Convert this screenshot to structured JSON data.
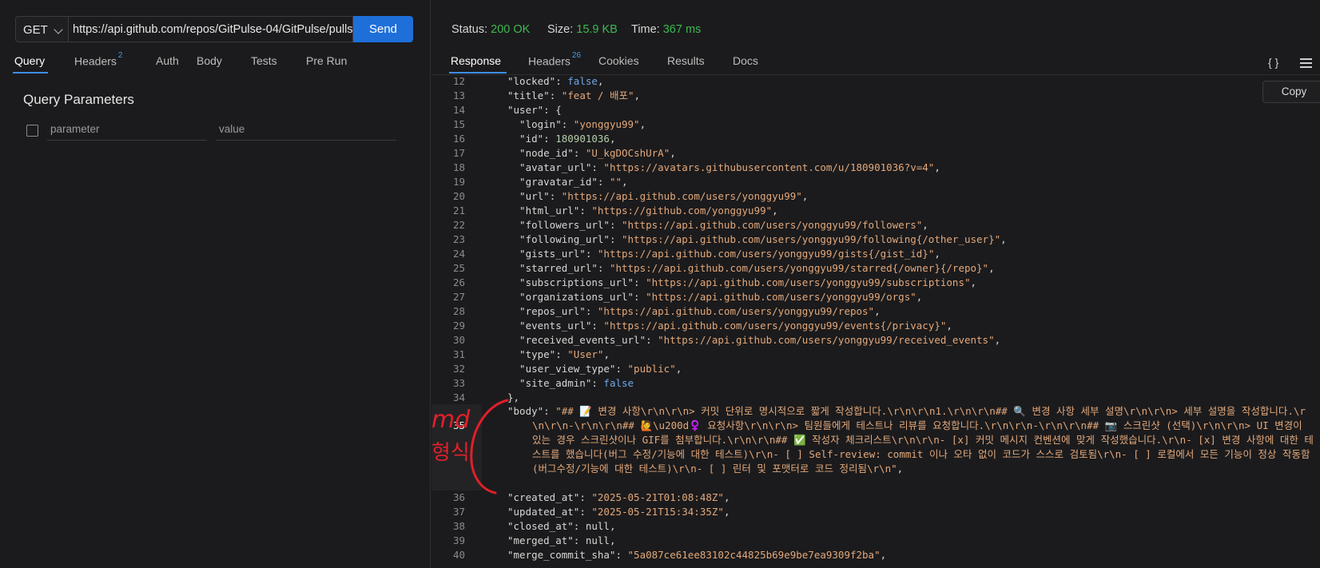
{
  "request": {
    "method": "GET",
    "url": "https://api.github.com/repos/GitPulse-04/GitPulse/pulls",
    "send_label": "Send"
  },
  "request_tabs": [
    {
      "label": "Query",
      "active": true
    },
    {
      "label": "Headers",
      "badge": "2"
    },
    {
      "label": "Auth"
    },
    {
      "label": "Body"
    },
    {
      "label": "Tests"
    },
    {
      "label": "Pre Run"
    }
  ],
  "query_params": {
    "title": "Query Parameters",
    "param_placeholder": "parameter",
    "value_placeholder": "value"
  },
  "status": {
    "status_label": "Status:",
    "status_value": "200 OK",
    "size_label": "Size:",
    "size_value": "15.9 KB",
    "time_label": "Time:",
    "time_value": "367 ms"
  },
  "response_tabs": [
    {
      "label": "Response",
      "active": true
    },
    {
      "label": "Headers",
      "badge": "26"
    },
    {
      "label": "Cookies"
    },
    {
      "label": "Results"
    },
    {
      "label": "Docs"
    }
  ],
  "toolbar": {
    "braces_glyph": "{ }",
    "copy_label": "Copy"
  },
  "code_lines": [
    {
      "n": "12",
      "parts": [
        [
          "k",
          "\"locked\""
        ],
        [
          "p",
          ": "
        ],
        [
          "b",
          "false"
        ],
        [
          "p",
          ","
        ]
      ]
    },
    {
      "n": "13",
      "parts": [
        [
          "k",
          "\"title\""
        ],
        [
          "p",
          ": "
        ],
        [
          "s",
          "\"feat / 배포\""
        ],
        [
          "p",
          ","
        ]
      ]
    },
    {
      "n": "14",
      "parts": [
        [
          "k",
          "\"user\""
        ],
        [
          "p",
          ": {"
        ]
      ]
    },
    {
      "n": "15",
      "parts": [
        [
          "k",
          "  \"login\""
        ],
        [
          "p",
          ": "
        ],
        [
          "s",
          "\"yonggyu99\""
        ],
        [
          "p",
          ","
        ]
      ]
    },
    {
      "n": "16",
      "parts": [
        [
          "k",
          "  \"id\""
        ],
        [
          "p",
          ": "
        ],
        [
          "n",
          "180901036"
        ],
        [
          "p",
          ","
        ]
      ]
    },
    {
      "n": "17",
      "parts": [
        [
          "k",
          "  \"node_id\""
        ],
        [
          "p",
          ": "
        ],
        [
          "s",
          "\"U_kgDOCshUrA\""
        ],
        [
          "p",
          ","
        ]
      ]
    },
    {
      "n": "18",
      "parts": [
        [
          "k",
          "  \"avatar_url\""
        ],
        [
          "p",
          ": "
        ],
        [
          "s",
          "\"https://avatars.githubusercontent.com/u/180901036?v=4\""
        ],
        [
          "p",
          ","
        ]
      ]
    },
    {
      "n": "19",
      "parts": [
        [
          "k",
          "  \"gravatar_id\""
        ],
        [
          "p",
          ": "
        ],
        [
          "s",
          "\"\""
        ],
        [
          "p",
          ","
        ]
      ]
    },
    {
      "n": "20",
      "parts": [
        [
          "k",
          "  \"url\""
        ],
        [
          "p",
          ": "
        ],
        [
          "s",
          "\"https://api.github.com/users/yonggyu99\""
        ],
        [
          "p",
          ","
        ]
      ]
    },
    {
      "n": "21",
      "parts": [
        [
          "k",
          "  \"html_url\""
        ],
        [
          "p",
          ": "
        ],
        [
          "s",
          "\"https://github.com/yonggyu99\""
        ],
        [
          "p",
          ","
        ]
      ]
    },
    {
      "n": "22",
      "parts": [
        [
          "k",
          "  \"followers_url\""
        ],
        [
          "p",
          ": "
        ],
        [
          "s",
          "\"https://api.github.com/users/yonggyu99/followers\""
        ],
        [
          "p",
          ","
        ]
      ]
    },
    {
      "n": "23",
      "parts": [
        [
          "k",
          "  \"following_url\""
        ],
        [
          "p",
          ": "
        ],
        [
          "s",
          "\"https://api.github.com/users/yonggyu99/following{/other_user}\""
        ],
        [
          "p",
          ","
        ]
      ]
    },
    {
      "n": "24",
      "parts": [
        [
          "k",
          "  \"gists_url\""
        ],
        [
          "p",
          ": "
        ],
        [
          "s",
          "\"https://api.github.com/users/yonggyu99/gists{/gist_id}\""
        ],
        [
          "p",
          ","
        ]
      ]
    },
    {
      "n": "25",
      "parts": [
        [
          "k",
          "  \"starred_url\""
        ],
        [
          "p",
          ": "
        ],
        [
          "s",
          "\"https://api.github.com/users/yonggyu99/starred{/owner}{/repo}\""
        ],
        [
          "p",
          ","
        ]
      ]
    },
    {
      "n": "26",
      "parts": [
        [
          "k",
          "  \"subscriptions_url\""
        ],
        [
          "p",
          ": "
        ],
        [
          "s",
          "\"https://api.github.com/users/yonggyu99/subscriptions\""
        ],
        [
          "p",
          ","
        ]
      ]
    },
    {
      "n": "27",
      "parts": [
        [
          "k",
          "  \"organizations_url\""
        ],
        [
          "p",
          ": "
        ],
        [
          "s",
          "\"https://api.github.com/users/yonggyu99/orgs\""
        ],
        [
          "p",
          ","
        ]
      ]
    },
    {
      "n": "28",
      "parts": [
        [
          "k",
          "  \"repos_url\""
        ],
        [
          "p",
          ": "
        ],
        [
          "s",
          "\"https://api.github.com/users/yonggyu99/repos\""
        ],
        [
          "p",
          ","
        ]
      ]
    },
    {
      "n": "29",
      "parts": [
        [
          "k",
          "  \"events_url\""
        ],
        [
          "p",
          ": "
        ],
        [
          "s",
          "\"https://api.github.com/users/yonggyu99/events{/privacy}\""
        ],
        [
          "p",
          ","
        ]
      ]
    },
    {
      "n": "30",
      "parts": [
        [
          "k",
          "  \"received_events_url\""
        ],
        [
          "p",
          ": "
        ],
        [
          "s",
          "\"https://api.github.com/users/yonggyu99/received_events\""
        ],
        [
          "p",
          ","
        ]
      ]
    },
    {
      "n": "31",
      "parts": [
        [
          "k",
          "  \"type\""
        ],
        [
          "p",
          ": "
        ],
        [
          "s",
          "\"User\""
        ],
        [
          "p",
          ","
        ]
      ]
    },
    {
      "n": "32",
      "parts": [
        [
          "k",
          "  \"user_view_type\""
        ],
        [
          "p",
          ": "
        ],
        [
          "s",
          "\"public\""
        ],
        [
          "p",
          ","
        ]
      ]
    },
    {
      "n": "33",
      "parts": [
        [
          "k",
          "  \"site_admin\""
        ],
        [
          "p",
          ": "
        ],
        [
          "b",
          "false"
        ]
      ]
    },
    {
      "n": "34",
      "parts": [
        [
          "p",
          "},"
        ]
      ]
    }
  ],
  "body_line": {
    "n": "35",
    "key": "\"body\"",
    "value": "\"## 📝 변경 사항\\r\\n\\r\\n> 커밋 단위로 명시적으로 짧게 작성합니다.\\r\\n\\r\\n1.\\r\\n\\r\\n## 🔍 변경 사항 세부 설명\\r\\n\\r\\n> 세부 설명을 작성합니다.\\r\\n\\r\\n-\\r\\n\\r\\n## 🙋\\u200d♀️ 요청사항\\r\\n\\r\\n> 팀원들에게 테스트나 리뷰를 요청합니다.\\r\\n\\r\\n-\\r\\n\\r\\n## 📷 스크린샷 (선택)\\r\\n\\r\\n> UI 변경이 있는 경우 스크린샷이나 GIF를 첨부합니다.\\r\\n\\r\\n## ✅ 작성자 체크리스트\\r\\n\\r\\n- [x] 커밋 메시지 컨벤션에 맞게 작성했습니다.\\r\\n- [x] 변경 사항에 대한 테스트를 했습니다(버그 수정/기능에 대한 테스트)\\r\\n- [ ] Self-review: commit 이나 오타 없이 코드가 스스로 검토됨\\r\\n- [ ] 로컬에서 모든 기능이 정상 작동함(버그수정/기능에 대한 테스트)\\r\\n- [ ] 린터 및 포맷터로 코드 정리됨\\r\\n\"",
    "trail": ","
  },
  "code_lines_after": [
    {
      "n": "36",
      "parts": [
        [
          "k",
          "\"created_at\""
        ],
        [
          "p",
          ": "
        ],
        [
          "s",
          "\"2025-05-21T01:08:48Z\""
        ],
        [
          "p",
          ","
        ]
      ]
    },
    {
      "n": "37",
      "parts": [
        [
          "k",
          "\"updated_at\""
        ],
        [
          "p",
          ": "
        ],
        [
          "s",
          "\"2025-05-21T15:34:35Z\""
        ],
        [
          "p",
          ","
        ]
      ]
    },
    {
      "n": "38",
      "parts": [
        [
          "k",
          "\"closed_at\""
        ],
        [
          "p",
          ": "
        ],
        [
          "p",
          "null"
        ],
        [
          "p",
          ","
        ]
      ]
    },
    {
      "n": "39",
      "parts": [
        [
          "k",
          "\"merged_at\""
        ],
        [
          "p",
          ": "
        ],
        [
          "p",
          "null"
        ],
        [
          "p",
          ","
        ]
      ]
    },
    {
      "n": "40",
      "parts": [
        [
          "k",
          "\"merge_commit_sha\""
        ],
        [
          "p",
          ": "
        ],
        [
          "s",
          "\"5a087ce61ee83102c44825b69e9be7ea9309f2ba\""
        ],
        [
          "p",
          ","
        ]
      ]
    }
  ],
  "annotation": {
    "text_line1": "md",
    "text_line2": "형식",
    "color": "#e0202a"
  },
  "colors": {
    "accent": "#1e6fd9",
    "status_ok": "#3fb950",
    "string": "#e3a87a",
    "number": "#b5cea8",
    "boolean": "#6ea7e6"
  }
}
